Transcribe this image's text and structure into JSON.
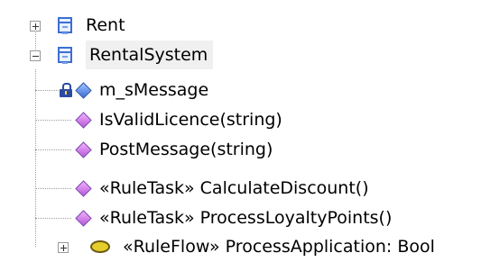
{
  "tree": {
    "nodes": [
      {
        "label": "Rent",
        "icon": "class-icon",
        "expander": "plus"
      },
      {
        "label": "RentalSystem",
        "icon": "class-icon",
        "expander": "minus",
        "selected": true
      },
      {
        "label": "m_sMessage",
        "icon": "private-attribute-icon"
      },
      {
        "label": "IsValidLicence(string)",
        "icon": "operation-icon"
      },
      {
        "label": "PostMessage(string)",
        "icon": "operation-icon"
      },
      {
        "label": "«RuleTask» CalculateDiscount()",
        "icon": "operation-icon"
      },
      {
        "label": "«RuleTask» ProcessLoyaltyPoints()",
        "icon": "operation-icon"
      },
      {
        "label": "«RuleFlow» ProcessApplication: Bool",
        "icon": "ruleflow-icon",
        "expander": "plus"
      }
    ]
  },
  "colors": {
    "class_icon_blue": "#3c6fd1",
    "operation_purple": "#b65ad6",
    "attribute_blue": "#3d6fd3",
    "ruleflow_yellow": "#e5cd2b",
    "selection_bg": "#f0f0f0"
  }
}
